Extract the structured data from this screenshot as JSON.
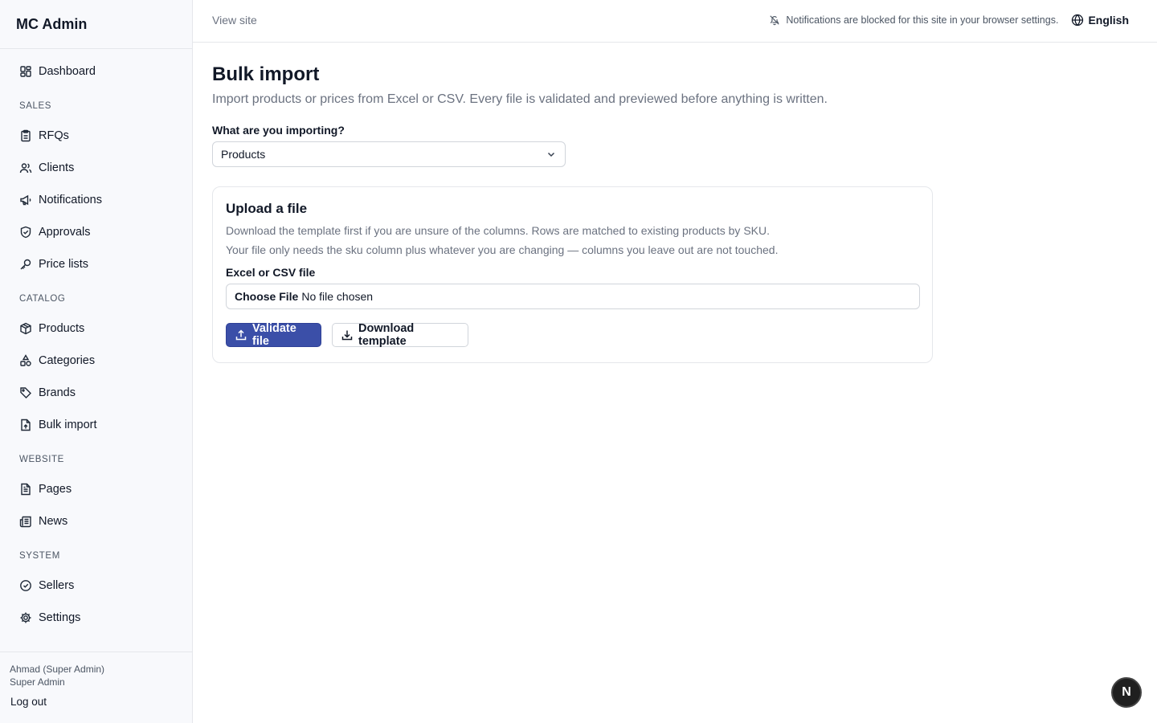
{
  "brand": "MC Admin",
  "sidebar": {
    "dashboard": {
      "label": "Dashboard",
      "icon": "dashboard-icon"
    },
    "sections": [
      {
        "title": "SALES",
        "items": [
          {
            "label": "RFQs",
            "icon": "clipboard-icon"
          },
          {
            "label": "Clients",
            "icon": "users-icon"
          },
          {
            "label": "Notifications",
            "icon": "megaphone-icon"
          },
          {
            "label": "Approvals",
            "icon": "shield-check-icon"
          },
          {
            "label": "Price lists",
            "icon": "key-icon"
          }
        ]
      },
      {
        "title": "CATALOG",
        "items": [
          {
            "label": "Products",
            "icon": "box-icon"
          },
          {
            "label": "Categories",
            "icon": "shapes-icon"
          },
          {
            "label": "Brands",
            "icon": "tag-icon"
          },
          {
            "label": "Bulk import",
            "icon": "file-upload-icon"
          }
        ]
      },
      {
        "title": "WEBSITE",
        "items": [
          {
            "label": "Pages",
            "icon": "file-text-icon"
          },
          {
            "label": "News",
            "icon": "newspaper-icon"
          }
        ]
      },
      {
        "title": "SYSTEM",
        "items": [
          {
            "label": "Sellers",
            "icon": "badge-check-icon"
          },
          {
            "label": "Settings",
            "icon": "gear-icon"
          }
        ]
      }
    ],
    "user": {
      "name": "Ahmad (Super Admin)",
      "role": "Super Admin",
      "logout": "Log out"
    }
  },
  "topbar": {
    "view_site": "View site",
    "notice": "Notifications are blocked for this site in your browser settings.",
    "language": "English"
  },
  "page": {
    "title": "Bulk import",
    "subtitle": "Import products or prices from Excel or CSV. Every file is validated and previewed before anything is written.",
    "import_label": "What are you importing?",
    "import_value": "Products"
  },
  "card": {
    "title": "Upload a file",
    "desc1": "Download the template first if you are unsure of the columns. Rows are matched to existing products by SKU.",
    "desc2": "Your file only needs the sku column plus whatever you are changing — columns you leave out are not touched.",
    "file_label": "Excel or CSV file",
    "choose_file": "Choose File",
    "no_file": "No file chosen",
    "validate": "Validate file",
    "download": "Download template"
  },
  "fab": "N",
  "colors": {
    "primary": "#3b4fa8",
    "sidebar_bg": "#f8f9fc",
    "border": "#e5e7eb"
  }
}
